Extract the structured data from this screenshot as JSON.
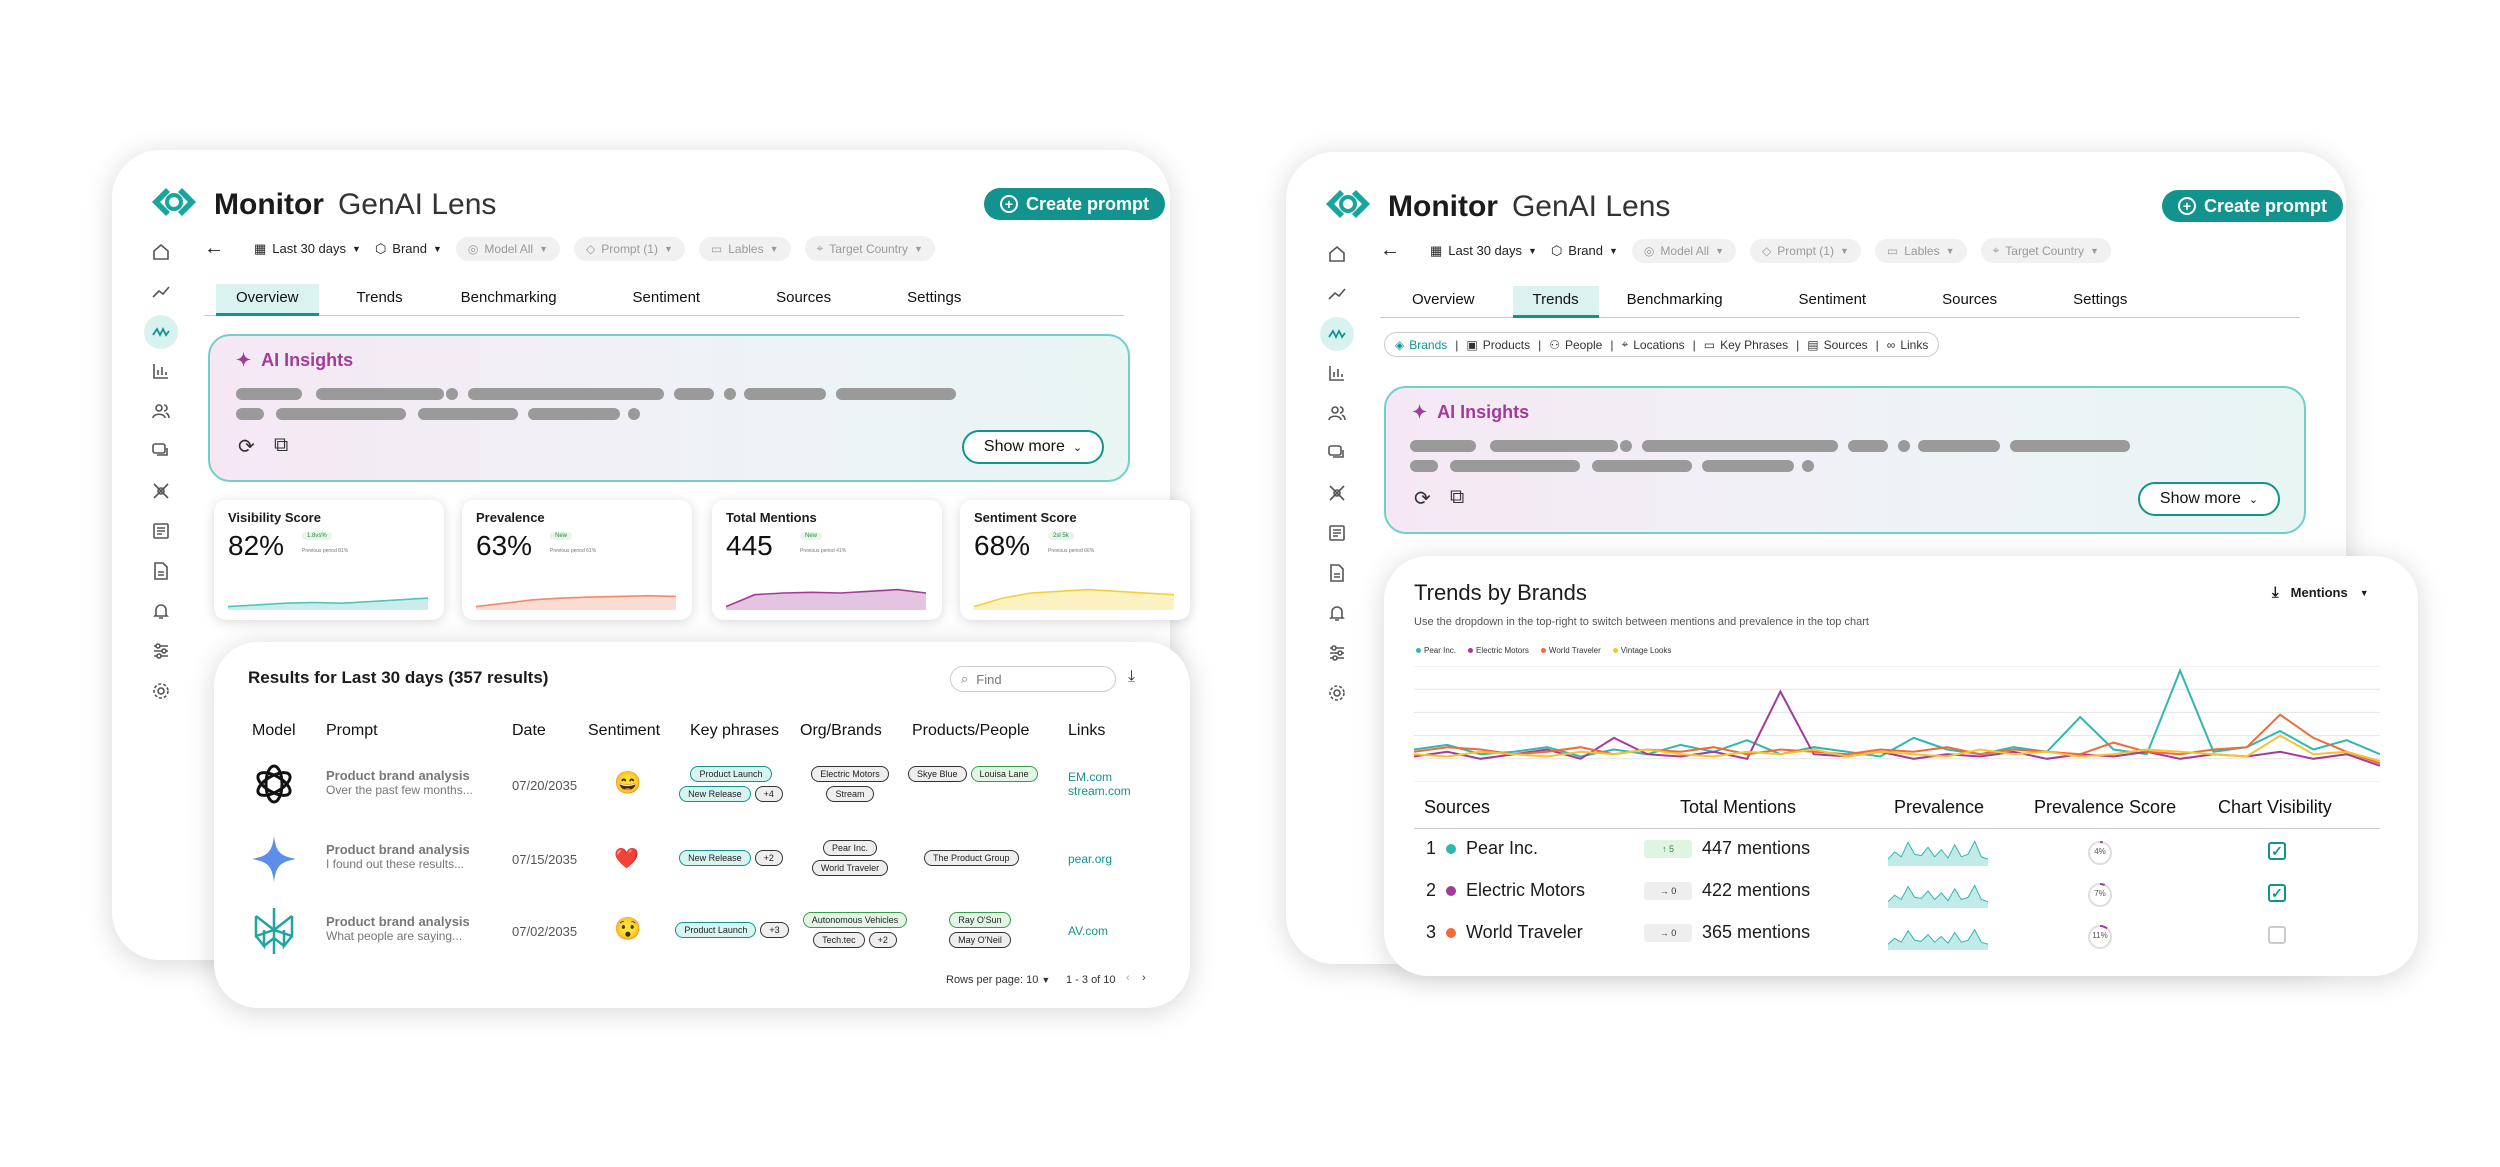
{
  "app": {
    "name_bold": "Monitor",
    "name_light": "GenAI Lens",
    "create_btn": "Create prompt"
  },
  "toolbar": {
    "period": "Last 30 days",
    "brand": "Brand",
    "model": "Model All",
    "prompt": "Prompt (1)",
    "labels": "Lables",
    "country": "Target Country"
  },
  "tabs": [
    "Overview",
    "Trends",
    "Benchmarking",
    "Sentiment",
    "Sources",
    "Settings"
  ],
  "insights": {
    "title": "AI Insights",
    "show_more": "Show more"
  },
  "kpis": [
    {
      "label": "Visibility Score",
      "value": "82%",
      "badge": "1.8vs%",
      "prev": "Previous period 81%",
      "color": "#4fc4bd",
      "trend": [
        0.1,
        0.15,
        0.2,
        0.22,
        0.2,
        0.25,
        0.3,
        0.35
      ]
    },
    {
      "label": "Prevalence",
      "value": "63%",
      "badge": "New",
      "prev": "Previous period 61%",
      "color": "#f08a6a",
      "trend": [
        0.1,
        0.2,
        0.3,
        0.35,
        0.38,
        0.4,
        0.42,
        0.4
      ]
    },
    {
      "label": "Total Mentions",
      "value": "445",
      "badge": "New",
      "prev": "Previous period 41%",
      "color": "#a23c9b",
      "trend": [
        0.1,
        0.45,
        0.5,
        0.52,
        0.5,
        0.55,
        0.6,
        0.5
      ]
    },
    {
      "label": "Sentiment Score",
      "value": "68%",
      "badge": "2sl 5k",
      "prev": "Previous period 66%",
      "color": "#f5d130",
      "trend": [
        0.1,
        0.35,
        0.5,
        0.55,
        0.6,
        0.55,
        0.5,
        0.45
      ]
    }
  ],
  "results": {
    "title": "Results for Last 30 days (357 results)",
    "find_placeholder": "Find",
    "headers": [
      "Model",
      "Prompt",
      "Date",
      "Sentiment",
      "Key phrases",
      "Org/Brands",
      "Products/People",
      "Links"
    ],
    "rows": [
      {
        "model": "openai-icon",
        "prompt_title": "Product brand analysis",
        "prompt_sub": "Over the past few months...",
        "date": "07/20/2035",
        "sentiment": "😄",
        "phrases": [
          "Product Launch",
          "New Release",
          "+4"
        ],
        "orgs": [
          "Electric Motors",
          "Stream"
        ],
        "people": [
          "Skye Blue",
          "Louisa Lane"
        ],
        "links": [
          "EM.com",
          "stream.com"
        ]
      },
      {
        "model": "gemini-icon",
        "prompt_title": "Product brand analysis",
        "prompt_sub": "I found out these results...",
        "date": "07/15/2035",
        "sentiment": "❤️",
        "phrases": [
          "New Release",
          "+2"
        ],
        "orgs": [
          "Pear Inc.",
          "World Traveler"
        ],
        "people": [
          "The Product Group"
        ],
        "links": [
          "pear.org"
        ]
      },
      {
        "model": "perplexity-icon",
        "prompt_title": "Product brand analysis",
        "prompt_sub": "What people are saying...",
        "date": "07/02/2035",
        "sentiment": "😯",
        "phrases": [
          "Product Launch",
          "+3"
        ],
        "orgs": [
          "Autonomous Vehicles",
          "Tech.tec",
          "+2"
        ],
        "people": [
          "Ray O'Sun",
          "May O'Neil"
        ],
        "links": [
          "AV.com"
        ]
      }
    ],
    "pager": "Rows per page: 10",
    "range": "1 - 3 of 10"
  },
  "subtabs": [
    "Brands",
    "Products",
    "People",
    "Locations",
    "Key Phrases",
    "Sources",
    "Links"
  ],
  "trends": {
    "title": "Trends by Brands",
    "desc": "Use the dropdown in the top-right to switch between mentions and prevalence in the top chart",
    "dropdown": "Mentions",
    "headers": [
      "Sources",
      "Total Mentions",
      "Prevalence",
      "Prevalence Score",
      "Chart Visibility"
    ],
    "rows": [
      {
        "rank": "1",
        "name": "Pear Inc.",
        "color": "#2fb8b0",
        "delta": "↑ 5",
        "mentions": "447 mentions",
        "score": "4%",
        "visible": true
      },
      {
        "rank": "2",
        "name": "Electric Motors",
        "color": "#a23c9b",
        "delta": "→ 0",
        "mentions": "422 mentions",
        "score": "7%",
        "visible": true
      },
      {
        "rank": "3",
        "name": "World Traveler",
        "color": "#f06a3a",
        "delta": "→ 0",
        "mentions": "365 mentions",
        "score": "11%",
        "visible": false
      }
    ]
  },
  "chart_data": {
    "type": "line",
    "title": "Trends by Brands",
    "series": [
      {
        "name": "Pear Inc.",
        "color": "#2fb8b0",
        "values": [
          14,
          16,
          12,
          13,
          15,
          11,
          14,
          12,
          16,
          13,
          18,
          12,
          15,
          13,
          11,
          19,
          14,
          12,
          15,
          13,
          28,
          14,
          12,
          48,
          13,
          15,
          22,
          14,
          18,
          12
        ]
      },
      {
        "name": "Electric Motors",
        "color": "#a23c9b",
        "values": [
          11,
          13,
          10,
          12,
          14,
          10,
          19,
          12,
          11,
          13,
          10,
          39,
          12,
          11,
          13,
          10,
          12,
          11,
          13,
          10,
          12,
          11,
          13,
          10,
          12,
          11,
          13,
          10,
          12,
          7
        ]
      },
      {
        "name": "World Traveler",
        "color": "#f06a3a",
        "values": [
          13,
          15,
          14,
          12,
          13,
          15,
          12,
          14,
          13,
          15,
          12,
          14,
          13,
          12,
          14,
          13,
          15,
          12,
          14,
          13,
          12,
          17,
          13,
          12,
          14,
          15,
          29,
          19,
          13,
          8
        ]
      },
      {
        "name": "Vintage Looks",
        "color": "#f5c230",
        "values": [
          12,
          11,
          13,
          12,
          11,
          13,
          12,
          14,
          12,
          11,
          13,
          12,
          14,
          11,
          13,
          12,
          11,
          14,
          12,
          13,
          11,
          12,
          14,
          13,
          12,
          11,
          20,
          12,
          13,
          9
        ]
      }
    ],
    "ylim": [
      0,
      50
    ],
    "grid": true,
    "legend": "top-left"
  }
}
